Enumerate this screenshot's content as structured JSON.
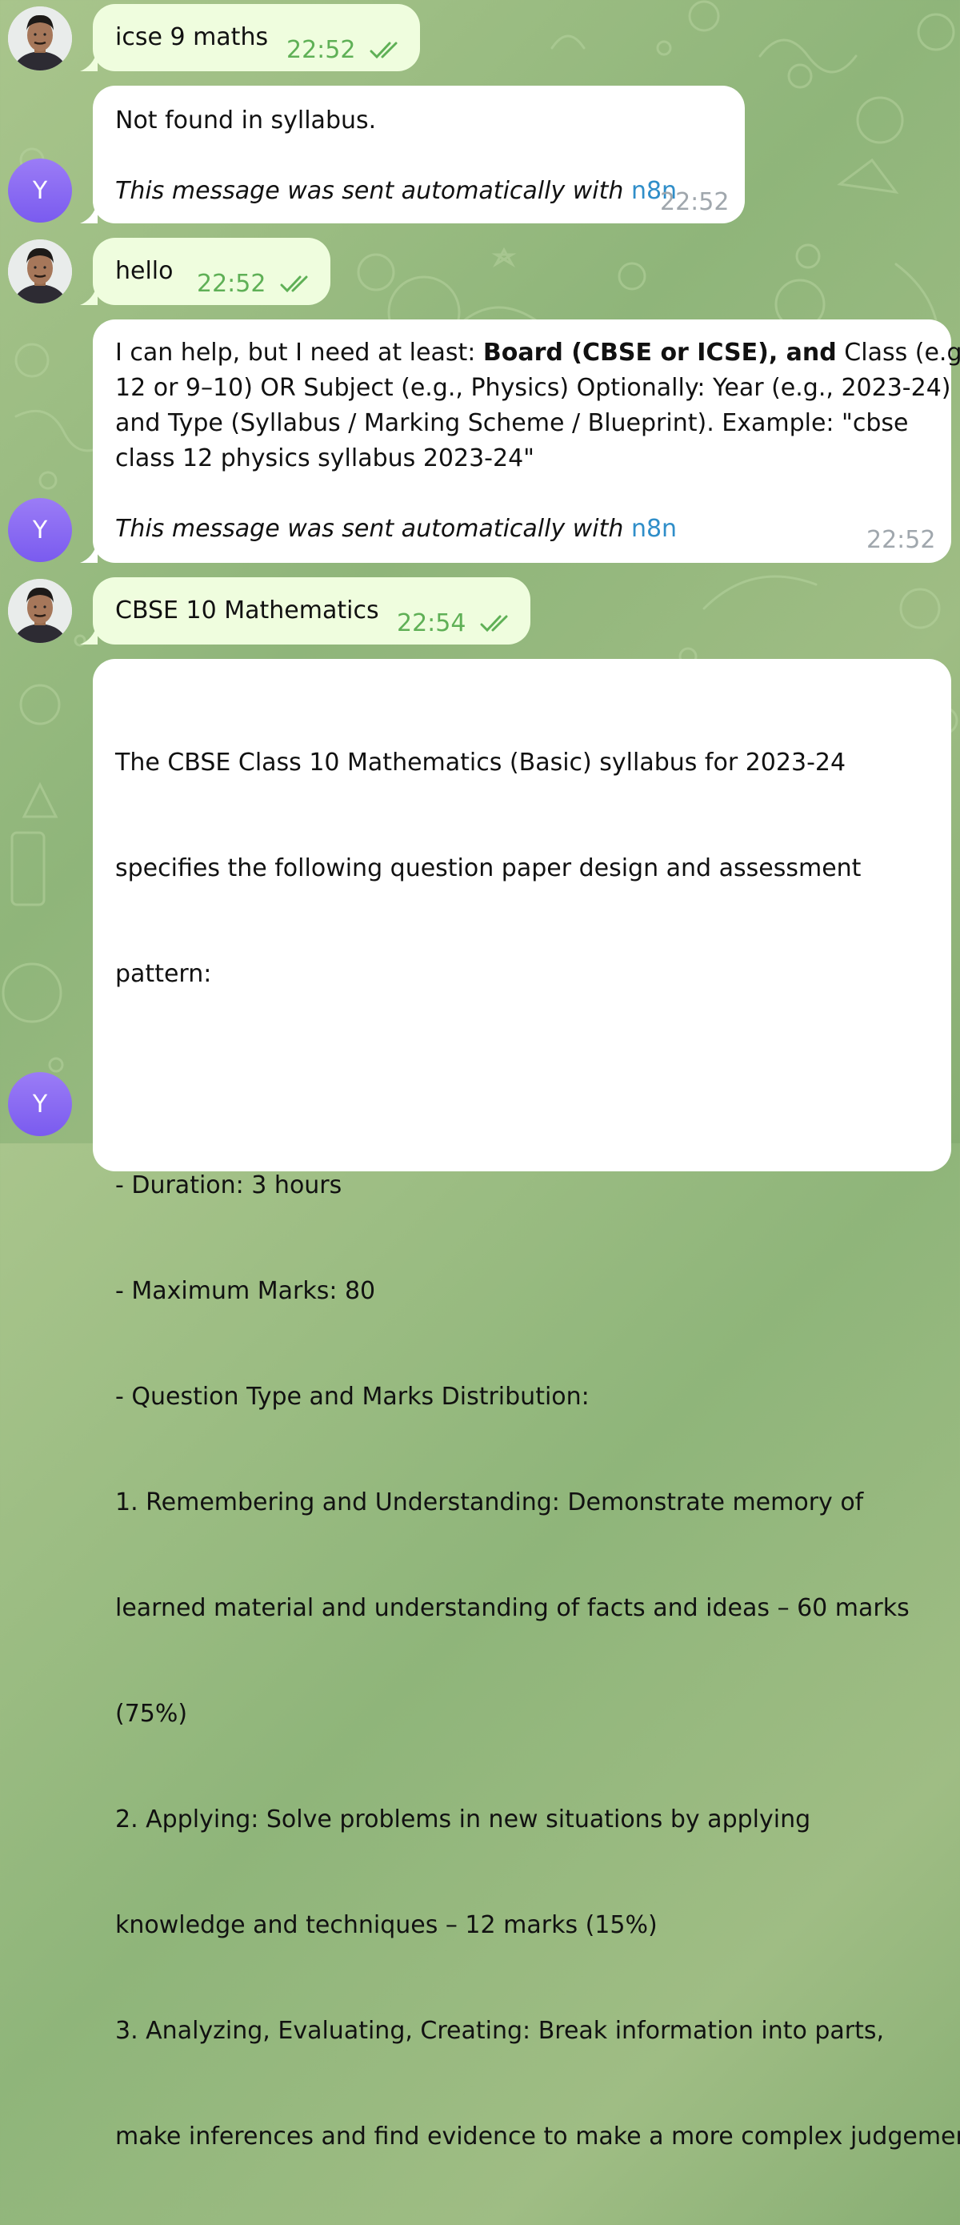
{
  "messages": [
    {
      "from": "user",
      "text": "icse 9 maths",
      "time": "22:52"
    },
    {
      "from": "bot",
      "avatar_letter": "Y",
      "text": "Not found in syllabus.",
      "auto_text": "This message was sent automatically with ",
      "auto_link": "n8n",
      "time": "22:52"
    },
    {
      "from": "user",
      "text": "hello",
      "time": "22:52"
    },
    {
      "from": "bot",
      "avatar_letter": "Y",
      "lines": [
        "I can help, but I need at least: ",
        "Board (CBSE or ICSE), and",
        " Class (e.g.,",
        "12 or 9–10) OR Subject (e.g., Physics)  Optionally: Year (e.g., 2023-24)",
        "and Type (Syllabus / Marking Scheme / Blueprint).  Example: \"cbse",
        "class 12 physics syllabus 2023-24\""
      ],
      "auto_text": "This message was sent automatically with ",
      "auto_link": "n8n",
      "time": "22:52"
    },
    {
      "from": "user",
      "text": "CBSE 10 Mathematics",
      "time": "22:54"
    },
    {
      "from": "bot",
      "avatar_letter": "Y",
      "lines": [
        "The CBSE Class 10 Mathematics (Basic) syllabus for 2023-24",
        "specifies the following question paper design and assessment",
        "pattern:",
        "",
        "- Duration: 3 hours",
        "- Maximum Marks: 80",
        "- Question Type and Marks Distribution:",
        "   1. Remembering and Understanding: Demonstrate memory of",
        "learned material and understanding of facts and ideas – 60 marks",
        "(75%)",
        "   2. Applying: Solve problems in new situations by applying",
        "knowledge and techniques – 12 marks (15%)",
        "   3. Analyzing, Evaluating, Creating: Break information into parts,",
        "make inferences and find evidence to make a more complex judgement"
      ]
    }
  ]
}
